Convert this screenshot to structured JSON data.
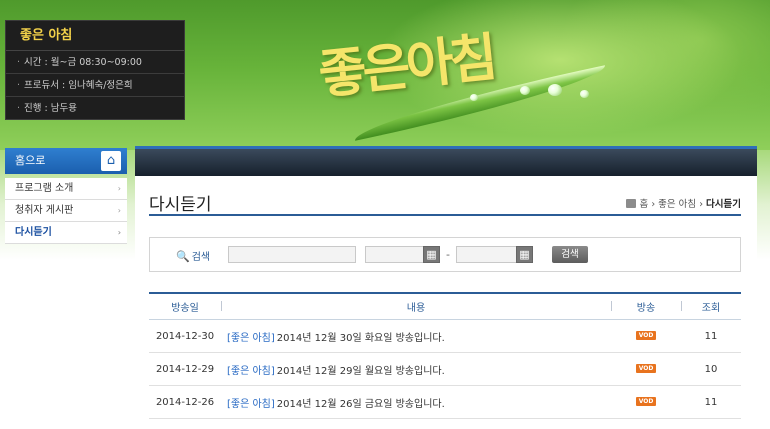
{
  "banner": {
    "logo_text": "좋은아침"
  },
  "info": {
    "title": "좋은 아침",
    "rows": [
      "시간 : 월~금 08:30~09:00",
      "프로듀서 : 임나혜숙/정은희",
      "진행 : 남두용"
    ]
  },
  "sidebar": {
    "home_label": "홈으로",
    "home_icon": "house-icon",
    "items": [
      {
        "label": "프로그램 소개",
        "active": false
      },
      {
        "label": "청취자 게시판",
        "active": false
      },
      {
        "label": "다시듣기",
        "active": true
      }
    ]
  },
  "page": {
    "title": "다시듣기",
    "breadcrumb": [
      "홈",
      "좋은 아침",
      "다시듣기"
    ]
  },
  "search": {
    "label": "검색",
    "button": "검색",
    "dash": "-",
    "calendar_icon": "calendar-icon"
  },
  "table": {
    "headers": [
      "방송일",
      "내용",
      "방송",
      "조회"
    ],
    "rows": [
      {
        "date": "2014-12-30",
        "category": "[좋은 아침]",
        "text": "2014년 12월 30일 화요일 방송입니다.",
        "vod": "VOD",
        "views": "11"
      },
      {
        "date": "2014-12-29",
        "category": "[좋은 아침]",
        "text": "2014년 12월 29일 월요일 방송입니다.",
        "vod": "VOD",
        "views": "10"
      },
      {
        "date": "2014-12-26",
        "category": "[좋은 아침]",
        "text": "2014년 12월 26일 금요일 방송입니다.",
        "vod": "VOD",
        "views": "11"
      }
    ]
  },
  "colors": {
    "accent": "#2b5c96",
    "vod_badge": "#e8731e",
    "info_title": "#f3d24a"
  }
}
